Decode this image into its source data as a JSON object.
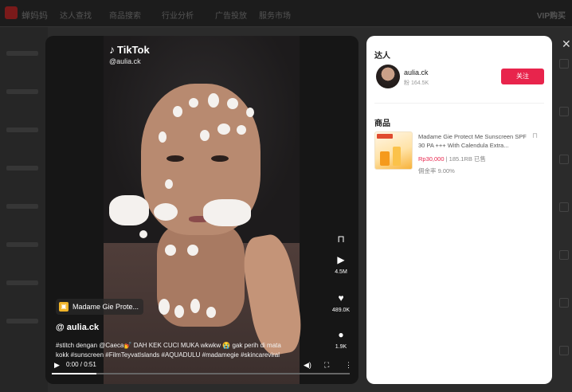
{
  "background": {
    "brand": "蝉妈妈",
    "nav": [
      "达人查找",
      "商品搜索",
      "行业分析",
      "广告投放",
      "服务市场"
    ],
    "vip": "VIP购买"
  },
  "video": {
    "watermark_logo": "TikTok",
    "watermark_handle": "@aulia.ck",
    "product_pill": "Madame Gie Prote...",
    "author": "@ aulia.ck",
    "caption": "#stitch dengan @Caeca💅 DAH KEK CUCI MUKA wkwkw 😭 gak perih di mata kokk #sunscreen #FilmTeyvatIslands #AQUADULU #madamegie #skincareviral",
    "actions": {
      "play_count": "4.5M",
      "like_count": "489.0K",
      "comment_count": "1.9K"
    },
    "time": "0:00 / 0:51",
    "progress": 0.15
  },
  "panel": {
    "creator_section": "达人",
    "creator_name": "aulia.ck",
    "creator_followers": "粉 164.5K",
    "follow_label": "关注",
    "products_section": "商品",
    "product": {
      "name": "Madame Gie Protect Me Sunscreen SPF 30 PA +++ With Calendula Extra...",
      "price": "Rp30,000",
      "sold": " | 185.1RB 已售",
      "commission": "佣金率 9.00%"
    }
  },
  "colors": {
    "accent": "#e8244c",
    "panel_bg": "#ffffff",
    "overlay_bg": "#2b2b2b"
  }
}
